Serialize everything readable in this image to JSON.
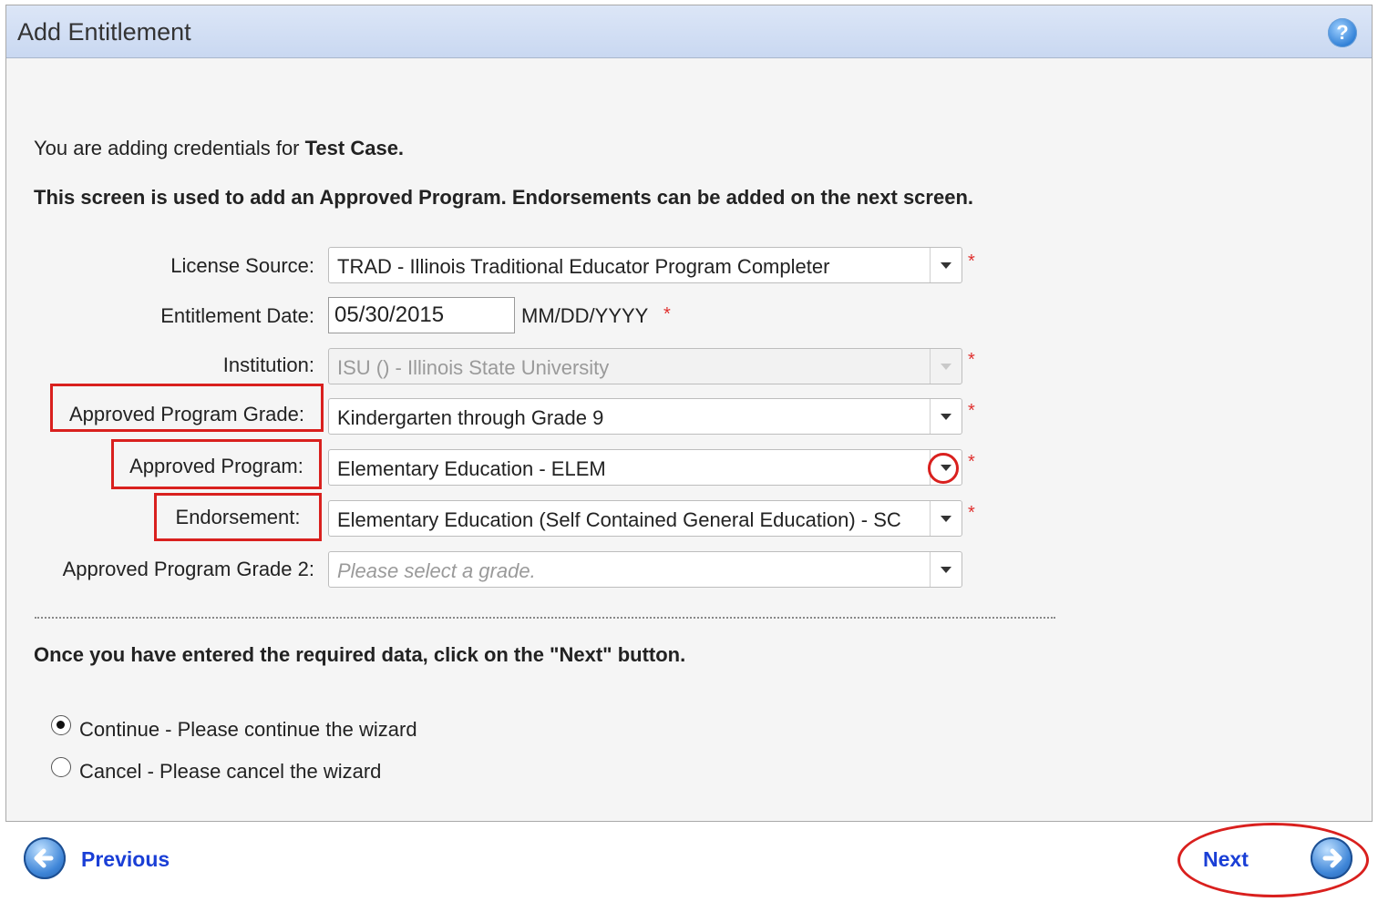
{
  "window": {
    "title": "Add Entitlement",
    "help_icon": "help-question-icon"
  },
  "intro": {
    "prefix": "You are adding credentials for ",
    "name": "Test Case.",
    "note": "This screen is used to add an Approved Program. Endorsements can be added on the next screen."
  },
  "form": {
    "license_source": {
      "label": "License Source:",
      "value": "TRAD - Illinois Traditional Educator Program Completer",
      "required": "*"
    },
    "entitlement_date": {
      "label": "Entitlement Date:",
      "value": "05/30/2015",
      "format_hint": "MM/DD/YYYY",
      "required": "*"
    },
    "institution": {
      "label": "Institution:",
      "value": "ISU () - Illinois State University",
      "required": "*"
    },
    "approved_program_grade": {
      "label": "Approved Program Grade:",
      "value": "Kindergarten through Grade 9",
      "required": "*"
    },
    "approved_program": {
      "label": "Approved Program:",
      "value": "Elementary Education - ELEM",
      "required": "*"
    },
    "endorsement": {
      "label": "Endorsement:",
      "value": "Elementary Education (Self Contained General Education) - SC",
      "required": "*"
    },
    "approved_program_grade_2": {
      "label": "Approved Program Grade 2:",
      "placeholder": "Please select a grade."
    }
  },
  "instruction": "Once you have entered the required data, click on the \"Next\" button.",
  "options": [
    {
      "label": "Continue - Please continue the wizard",
      "checked": true
    },
    {
      "label": "Cancel - Please cancel the wizard",
      "checked": false
    }
  ],
  "navigation": {
    "previous_label": "Previous",
    "next_label": "Next"
  },
  "colors": {
    "header_bg": "#dce6f7",
    "link": "#1a3fd6",
    "required": "#e0302e",
    "annotation": "#d9201e"
  }
}
